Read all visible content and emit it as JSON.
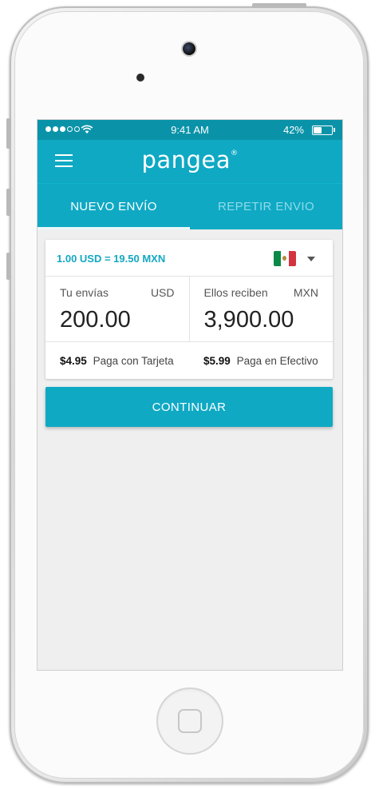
{
  "status_bar": {
    "time": "9:41 AM",
    "battery_percent": "42%",
    "battery_level": 0.42,
    "signal_bars_filled": 3,
    "signal_bars_total": 5
  },
  "app_bar": {
    "logo": "pangea",
    "logo_mark": "®"
  },
  "tabs": [
    {
      "label": "NUEVO ENVÍO",
      "active": true
    },
    {
      "label": "REPETIR ENVIO",
      "active": false
    }
  ],
  "transfer_card": {
    "exchange_rate": "1.00 USD = 19.50 MXN",
    "country_flag_icon": "mexico-flag-icon",
    "send": {
      "label": "Tu envías",
      "currency": "USD",
      "amount": "200.00"
    },
    "receive": {
      "label": "Ellos reciben",
      "currency": "MXN",
      "amount": "3,900.00"
    },
    "fees": [
      {
        "amount": "$4.95",
        "label": "Paga con Tarjeta"
      },
      {
        "amount": "$5.99",
        "label": "Paga en Efectivo"
      }
    ]
  },
  "continue_button": {
    "label": "CONTINUAR"
  },
  "colors": {
    "brand": "#0fa9c4",
    "status_bar": "#0a93a8",
    "rate_text": "#14a7c3",
    "background": "#efefef"
  }
}
